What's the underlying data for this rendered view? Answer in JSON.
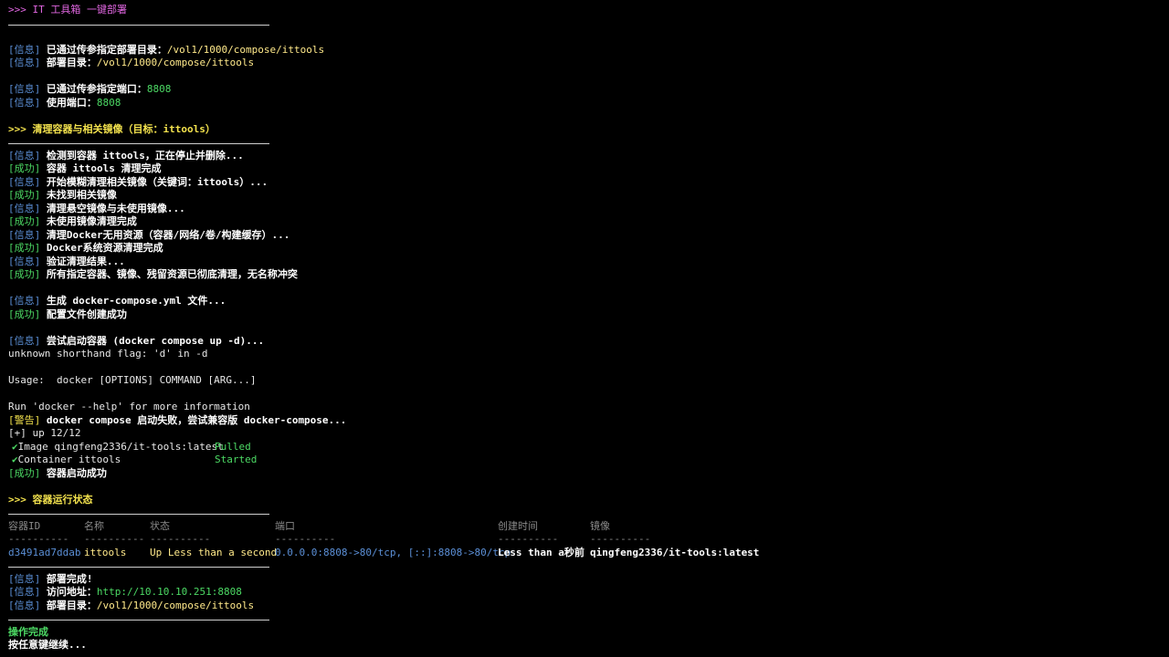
{
  "header": {
    "prompt": ">>> ",
    "title": "IT 工具箱 一键部署"
  },
  "tags": {
    "info": "[信息]",
    "ok": "[成功]",
    "warn": "[警告]"
  },
  "params": {
    "dir_passed_label": "已通过传参指定部署目录：",
    "dir_passed_value": "/vol1/1000/compose/ittools",
    "dir_label": "部署目录：",
    "dir_value": "/vol1/1000/compose/ittools",
    "port_passed_label": "已通过传参指定端口：",
    "port_passed_value": "8808",
    "port_label": "使用端口：",
    "port_value": "8808"
  },
  "cleanup": {
    "section_title": ">>> 清理容器与相关镜像（目标：ittools）",
    "lines": [
      {
        "tag": "info",
        "text": "检测到容器 ittools，正在停止并删除..."
      },
      {
        "tag": "ok",
        "text": "容器 ittools 清理完成"
      },
      {
        "tag": "info",
        "text": "开始模糊清理相关镜像（关键词：ittools）..."
      },
      {
        "tag": "ok",
        "text": "未找到相关镜像"
      },
      {
        "tag": "info",
        "text": "清理悬空镜像与未使用镜像..."
      },
      {
        "tag": "ok",
        "text": "未使用镜像清理完成"
      },
      {
        "tag": "info",
        "text": "清理Docker无用资源（容器/网络/卷/构建缓存）..."
      },
      {
        "tag": "ok",
        "text": "Docker系统资源清理完成"
      },
      {
        "tag": "info",
        "text": "验证清理结果..."
      },
      {
        "tag": "ok",
        "text": "所有指定容器、镜像、残留资源已彻底清理，无名称冲突"
      }
    ]
  },
  "compose": {
    "gen_text": "生成 docker-compose.yml 文件...",
    "gen_ok": "配置文件创建成功"
  },
  "start": {
    "try_text": "尝试启动容器 (docker compose up -d)...",
    "err1": "unknown shorthand flag: 'd' in -d",
    "usage": "Usage:  docker [OPTIONS] COMMAND [ARG...]",
    "help": "Run 'docker --help' for more information",
    "warn_text": "docker compose 启动失败，尝试兼容版 docker-compose...",
    "up_line": "[+] up 12/12",
    "check": "✔",
    "item1_name": "Image qingfeng2336/it-tools:latest",
    "item1_status": "Pulled",
    "item2_name": "Container ittools",
    "item2_status": "Started",
    "start_ok": "容器启动成功"
  },
  "status": {
    "section_title": ">>> 容器运行状态",
    "headers": [
      "容器ID",
      "名称",
      "状态",
      "端口",
      "创建时间",
      "镜像"
    ],
    "dashes": [
      "----------",
      "----------",
      "----------",
      "----------",
      "----------",
      "----------"
    ],
    "row": [
      "d3491ad7ddab",
      "ittools",
      "Up Less than a second",
      "0.0.0.0:8808->80/tcp, [::]:8808->80/tcp",
      "Less than a秒前",
      "qingfeng2336/it-tools:latest"
    ]
  },
  "done": {
    "complete_label": "部署完成!",
    "access_label": "访问地址：",
    "access_url": "http://10.10.10.251:8808",
    "dir_label": "部署目录：",
    "dir_value": "/vol1/1000/compose/ittools",
    "op_done": "操作完成",
    "press_key": "按任意键继续..."
  }
}
